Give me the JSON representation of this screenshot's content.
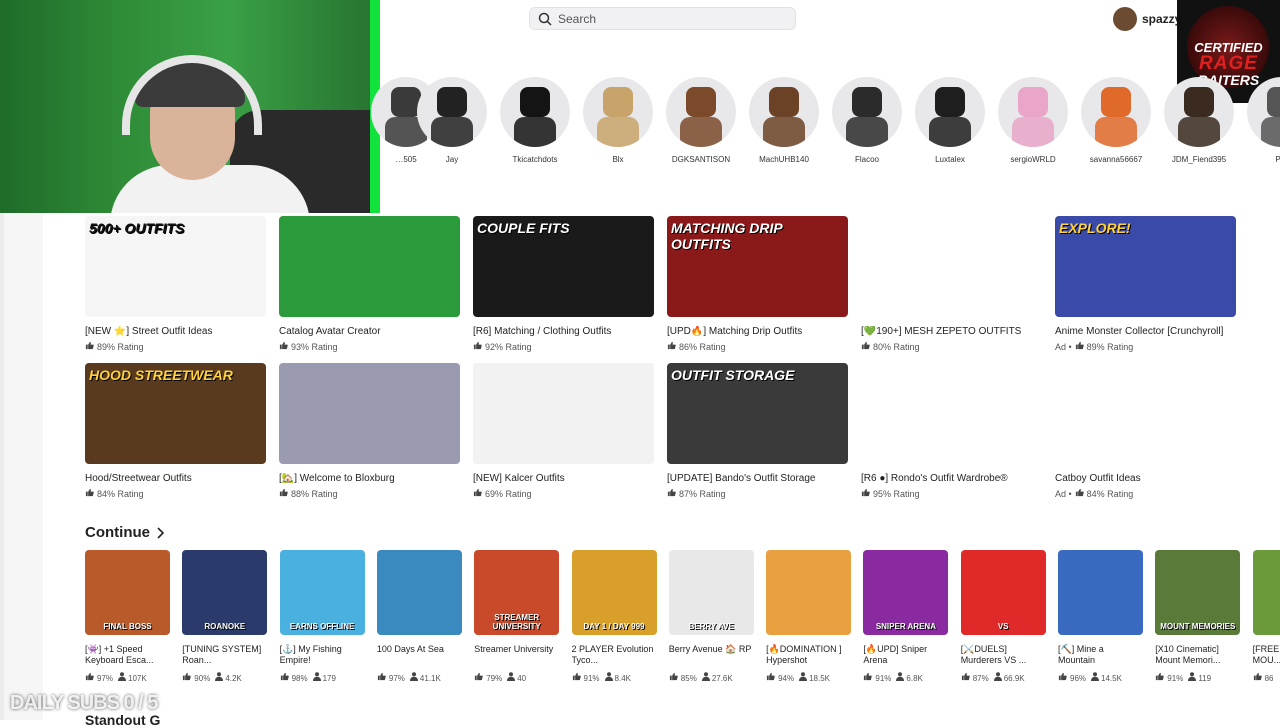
{
  "search": {
    "placeholder": "Search"
  },
  "user": {
    "name": "spazzy"
  },
  "badge": {
    "line1": "CERTIFIED",
    "line2": "RAGE",
    "line3": "BAITERS"
  },
  "friends": [
    {
      "name": "…505",
      "color": "#3a3a3a"
    },
    {
      "name": "Jay",
      "color": "#222222"
    },
    {
      "name": "Tkicatchdots",
      "color": "#141414"
    },
    {
      "name": "Blx",
      "color": "#c8a36a"
    },
    {
      "name": "DGKSANTISON",
      "color": "#7a4a2a"
    },
    {
      "name": "MachUHB140",
      "color": "#6b4226"
    },
    {
      "name": "Flacoo",
      "color": "#2b2b2b"
    },
    {
      "name": "Luxtalex",
      "color": "#1e1e1e"
    },
    {
      "name": "sergioWRLD",
      "color": "#e9a6c8"
    },
    {
      "name": "savanna56667",
      "color": "#e06a2a"
    },
    {
      "name": "JDM_Fiend395",
      "color": "#3a2a20"
    },
    {
      "name": "Psy",
      "color": "#555555"
    }
  ],
  "row1": [
    {
      "title": "[NEW ⭐] Street Outfit Ideas",
      "rating": "89% Rating",
      "cap": "500+ OUTFITS",
      "bg": "#f5f5f5",
      "fg": "#111111"
    },
    {
      "title": "Catalog Avatar Creator",
      "rating": "93% Rating",
      "cap": "",
      "bg": "#2a9a3a",
      "fg": "#ffffff"
    },
    {
      "title": "[R6] Matching / Clothing Outfits",
      "rating": "92% Rating",
      "cap": "COUPLE FITS",
      "bg": "#1a1a1a",
      "fg": "#ffffff"
    },
    {
      "title": "[UPD🔥] Matching Drip Outfits",
      "rating": "86% Rating",
      "cap": "MATCHING DRIP OUTFITS",
      "bg": "#8a1a1a",
      "fg": "#ffffff"
    },
    {
      "title": "[💚190+] MESH ZEPETO OUTFITS",
      "rating": "80% Rating",
      "cap": "",
      "bg": "#ffffff",
      "fg": "#ffffff"
    },
    {
      "title": "Anime Monster Collector [Crunchyroll]",
      "rating": "89% Rating",
      "ad": "Ad •",
      "cap": "EXPLORE!",
      "bg": "#3a4aa8",
      "fg": "#ffd23a"
    }
  ],
  "row2": [
    {
      "title": "Hood/Streetwear Outfits",
      "rating": "84% Rating",
      "cap": "HOOD STREETWEAR",
      "bg": "#5a3a1e",
      "fg": "#ffd23a"
    },
    {
      "title": "[🏡] Welcome to Bloxburg",
      "rating": "88% Rating",
      "cap": "",
      "bg": "#9a9ab0",
      "fg": "#ffffff"
    },
    {
      "title": "[NEW] Kalcer Outfits",
      "rating": "69% Rating",
      "cap": "",
      "bg": "#f2f2f2",
      "fg": "#111111"
    },
    {
      "title": "[UPDATE] Bando's Outfit Storage",
      "rating": "87% Rating",
      "cap": "OUTFIT STORAGE",
      "bg": "#3a3a3a",
      "fg": "#ffffff"
    },
    {
      "title": "[R6 ●] Rondo's Outfit Wardrobe®",
      "rating": "95% Rating",
      "cap": "",
      "bg": "#ffffff",
      "fg": "#ffffff"
    },
    {
      "title": "Catboy Outfit Ideas",
      "rating": "84% Rating",
      "ad": "Ad •",
      "cap": "",
      "bg": "#ffffff",
      "fg": "#ffffff"
    }
  ],
  "continue_label": "Continue",
  "continue_games": [
    {
      "title": "[👾] +1 Speed Keyboard Esca...",
      "rating": "97%",
      "players": "107K",
      "label": "FINAL BOSS",
      "bg": "#b85a2a"
    },
    {
      "title": "[TUNING SYSTEM] Roan...",
      "rating": "90%",
      "players": "4.2K",
      "label": "ROANOKE",
      "bg": "#2a3a6a"
    },
    {
      "title": "[⚓] My Fishing Empire!",
      "rating": "98%",
      "players": "179",
      "label": "EARNS OFFLINE",
      "bg": "#4ab0e0"
    },
    {
      "title": "100 Days At Sea",
      "rating": "97%",
      "players": "41.1K",
      "label": "",
      "bg": "#3a8ac0"
    },
    {
      "title": "Streamer University",
      "rating": "79%",
      "players": "40",
      "label": "STREAMER UNIVERSITY",
      "bg": "#c84a2a"
    },
    {
      "title": "2 PLAYER Evolution Tyco...",
      "rating": "91%",
      "players": "8.4K",
      "label": "DAY 1 / DAY 999",
      "bg": "#d8a02a"
    },
    {
      "title": "Berry Avenue 🏠 RP",
      "rating": "85%",
      "players": "27.6K",
      "label": "BERRY AVE",
      "bg": "#e8e8e8"
    },
    {
      "title": "[🔥DOMINATION ] Hypershot",
      "rating": "94%",
      "players": "18.5K",
      "label": "",
      "bg": "#e8a040"
    },
    {
      "title": "[🔥UPD] Sniper Arena",
      "rating": "91%",
      "players": "6.8K",
      "label": "SNIPER ARENA",
      "bg": "#8a2aa0"
    },
    {
      "title": "[⚔️DUELS] Murderers VS ...",
      "rating": "87%",
      "players": "66.9K",
      "label": "VS",
      "bg": "#e02a2a"
    },
    {
      "title": "[⛏️] Mine a Mountain",
      "rating": "96%",
      "players": "14.5K",
      "label": "",
      "bg": "#3a6ac0"
    },
    {
      "title": "[X10 Cinematic] Mount Memori...",
      "rating": "91%",
      "players": "119",
      "label": "MOUNT MEMORIES",
      "bg": "#5a7a3a"
    },
    {
      "title": "[FREE MOU...",
      "rating": "86",
      "players": "",
      "label": "",
      "bg": "#6a9a3a"
    }
  ],
  "watermark": "DAILY SUBS 0 / 5",
  "next_heading": "Standout G"
}
